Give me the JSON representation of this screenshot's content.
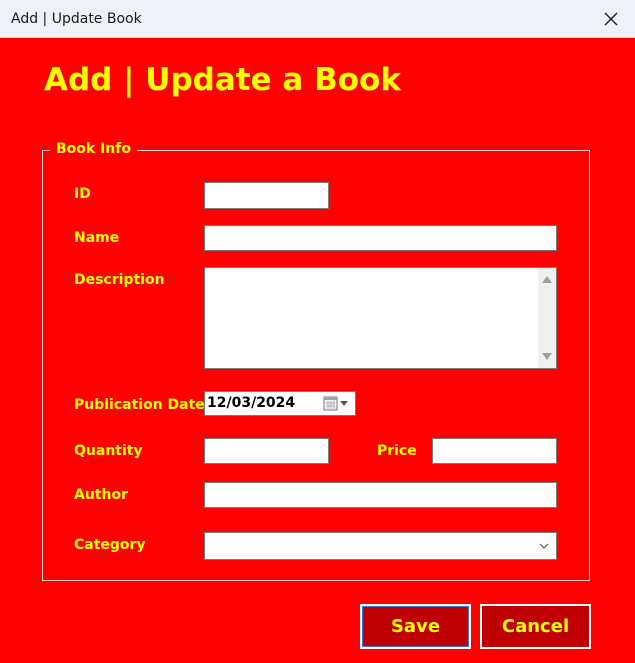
{
  "window": {
    "title": "Add | Update Book"
  },
  "heading": "Add | Update a Book",
  "groupbox": {
    "legend": "Book Info"
  },
  "fields": {
    "id": {
      "label": "ID",
      "value": ""
    },
    "name": {
      "label": "Name",
      "value": ""
    },
    "description": {
      "label": "Description",
      "value": ""
    },
    "publication_date": {
      "label": "Publication Date",
      "value": "12/03/2024"
    },
    "quantity": {
      "label": "Quantity",
      "value": ""
    },
    "price": {
      "label": "Price",
      "value": ""
    },
    "author": {
      "label": "Author",
      "value": ""
    },
    "category": {
      "label": "Category",
      "value": ""
    }
  },
  "buttons": {
    "save": "Save",
    "cancel": "Cancel"
  },
  "icons": {
    "close": "close-icon",
    "calendar": "calendar-icon",
    "dropdown": "chevron-down-icon"
  },
  "colors": {
    "background": "#ff0000",
    "text": "#ffff00",
    "button": "#c00000"
  }
}
